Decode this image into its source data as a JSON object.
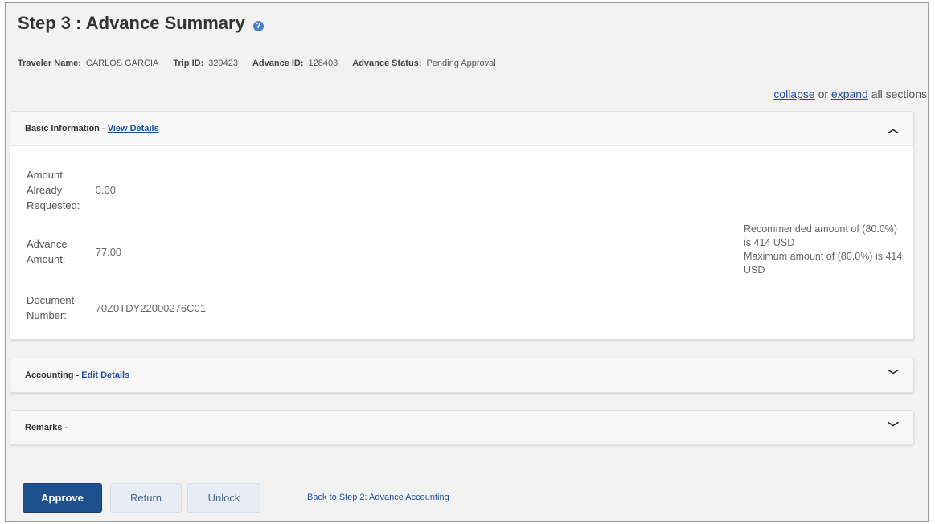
{
  "header": {
    "title": "Step 3 : Advance Summary",
    "help_icon": "question-icon"
  },
  "info": {
    "traveler_label": "Traveler Name:",
    "traveler_value": "CARLOS GARCIA",
    "trip_label": "Trip ID:",
    "trip_value": "329423",
    "advance_label": "Advance ID:",
    "advance_value": "128403",
    "status_label": "Advance Status:",
    "status_value": "Pending Approval"
  },
  "sections_toggle": {
    "collapse": "collapse",
    "or": "or",
    "expand": "expand",
    "suffix": "all sections"
  },
  "basic": {
    "title": "Basic Information -",
    "link": "View Details",
    "fields": [
      {
        "label": "Amount Already Requested:",
        "value": "0.00"
      },
      {
        "label": "Advance Amount:",
        "value": "77.00"
      },
      {
        "label": "Document Number:",
        "value": "70Z0TDY22000276C01"
      }
    ],
    "note_line1": "Recommended amount of (80.0%) is 414 USD",
    "note_line2": "Maximum amount of (80.0%) is 414 USD"
  },
  "accounting": {
    "title": "Accounting -",
    "link": "Edit Details"
  },
  "remarks": {
    "title": "Remarks -"
  },
  "buttons": {
    "approve": "Approve",
    "return": "Return",
    "unlock": "Unlock",
    "back_link": "Back to Step 2: Advance Accounting"
  }
}
